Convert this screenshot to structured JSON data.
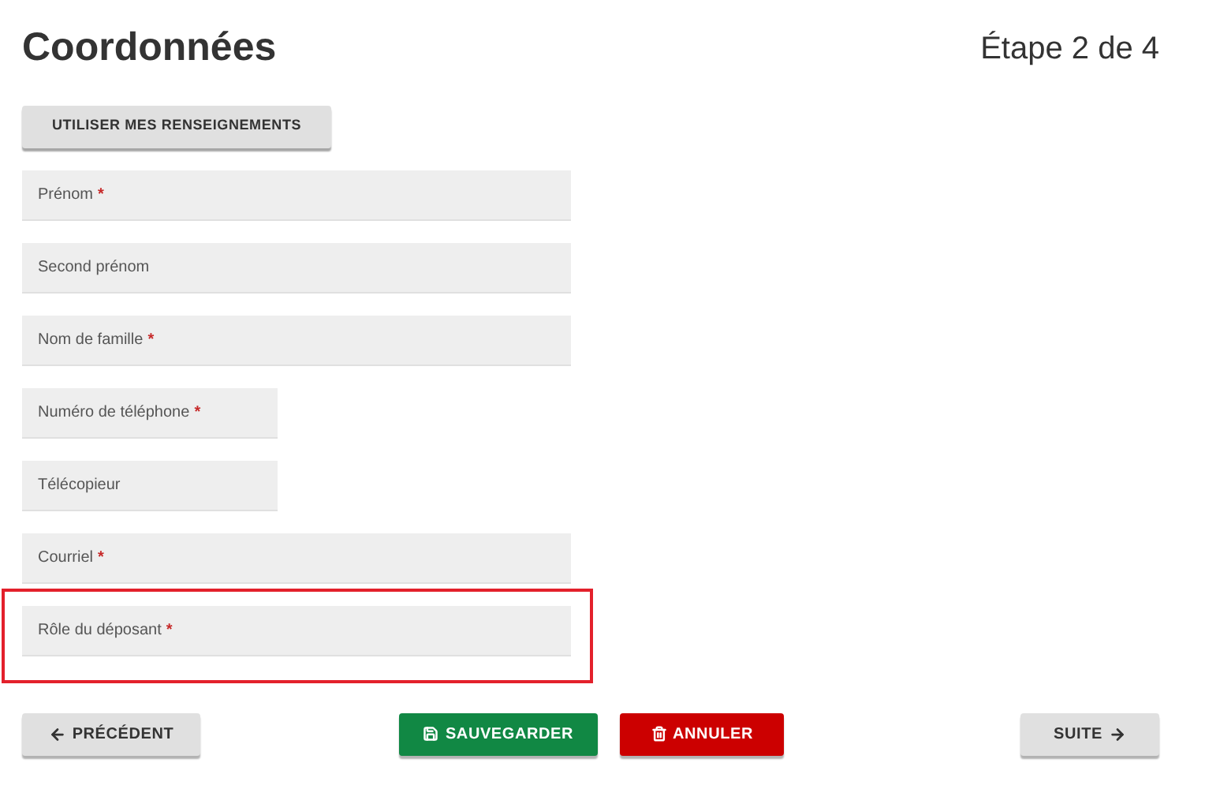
{
  "title": "Coordonnées",
  "step": "Étape 2 de 4",
  "prefill_button": "UTILISER MES RENSEIGNEMENTS",
  "fields": [
    {
      "label": "Prénom",
      "required": true,
      "kind": "full",
      "highlighted": false
    },
    {
      "label": "Second prénom",
      "required": false,
      "kind": "full",
      "highlighted": false
    },
    {
      "label": "Nom de famille",
      "required": true,
      "kind": "full",
      "highlighted": false
    },
    {
      "label": "Numéro de téléphone",
      "required": true,
      "kind": "short",
      "highlighted": false
    },
    {
      "label": "Télécopieur",
      "required": false,
      "kind": "short",
      "highlighted": false
    },
    {
      "label": "Courriel",
      "required": true,
      "kind": "full",
      "highlighted": false
    },
    {
      "label": "Rôle du déposant",
      "required": true,
      "kind": "full",
      "highlighted": true
    }
  ],
  "required_mark": "*",
  "buttons": [
    {
      "label": "PRÉCÉDENT",
      "kind": "back"
    },
    {
      "label": "SAUVEGARDER",
      "kind": "save"
    },
    {
      "label": "ANNULER",
      "kind": "cancel"
    },
    {
      "label": "SUITE",
      "kind": "next"
    }
  ]
}
